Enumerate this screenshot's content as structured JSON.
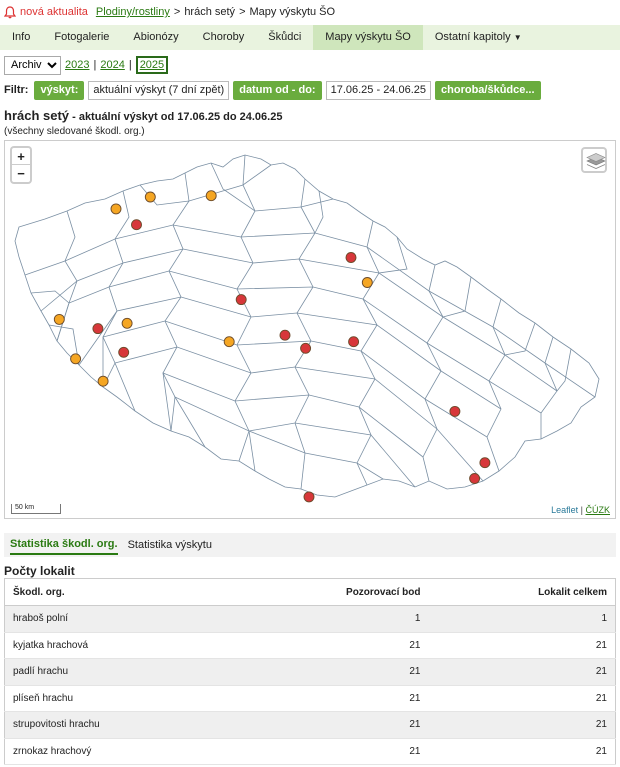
{
  "topbar": {
    "alert_label": "nová aktualita",
    "crumb_link": "Plodiny/rostliny",
    "crumb_sep1": ">",
    "crumb_2": "hrách setý",
    "crumb_sep2": ">",
    "crumb_3": "Mapy výskytu ŠO",
    "icon": "bell-icon"
  },
  "nav": {
    "items": [
      "Info",
      "Fotogalerie",
      "Abionózy",
      "Choroby",
      "Škůdci",
      "Mapy výskytu ŠO",
      "Ostatní kapitoly"
    ],
    "active": "Mapy výskytu ŠO"
  },
  "archive": {
    "select_value": "Archiv",
    "years": [
      "2023",
      "2024",
      "2025"
    ],
    "current_year": "2025",
    "sep": "|"
  },
  "filter": {
    "label": "Filtr:",
    "occurrence_btn": "výskyt:",
    "occurrence_value": "aktuální výskyt (7 dní zpět)",
    "date_btn": "datum od - do:",
    "date_value": "17.06.25 - 24.06.25",
    "disease_btn": "choroba/škůdce..."
  },
  "heading": {
    "crop": "hrách setý",
    "subtitle": " - aktuální výskyt od 17.06.25 do 24.06.25",
    "note": "(všechny sledované škodl. org.)"
  },
  "map": {
    "zoom_in": "+",
    "zoom_out": "−",
    "scale_label": "50 km",
    "attrib_leaflet": "Leaflet",
    "attrib_sep": "|",
    "attrib_cuzk": "ČÚZK",
    "marker_colors": {
      "orange": "#f5a623",
      "red": "#d7373a"
    },
    "markers": [
      {
        "color": "orange",
        "lon": 13.2,
        "lat": 50.66
      },
      {
        "color": "orange",
        "lon": 13.6,
        "lat": 50.75
      },
      {
        "color": "orange",
        "lon": 14.31,
        "lat": 50.76
      },
      {
        "color": "red",
        "lon": 13.44,
        "lat": 50.54
      },
      {
        "color": "red",
        "lon": 15.94,
        "lat": 50.29
      },
      {
        "color": "orange",
        "lon": 16.13,
        "lat": 50.1
      },
      {
        "color": "red",
        "lon": 14.66,
        "lat": 49.97
      },
      {
        "color": "orange",
        "lon": 12.54,
        "lat": 49.82
      },
      {
        "color": "red",
        "lon": 12.99,
        "lat": 49.75
      },
      {
        "color": "orange",
        "lon": 13.33,
        "lat": 49.79
      },
      {
        "color": "red",
        "lon": 13.29,
        "lat": 49.57
      },
      {
        "color": "orange",
        "lon": 12.73,
        "lat": 49.52
      },
      {
        "color": "orange",
        "lon": 13.05,
        "lat": 49.35
      },
      {
        "color": "orange",
        "lon": 14.52,
        "lat": 49.65
      },
      {
        "color": "red",
        "lon": 15.17,
        "lat": 49.7
      },
      {
        "color": "red",
        "lon": 15.41,
        "lat": 49.6
      },
      {
        "color": "red",
        "lon": 15.97,
        "lat": 49.65
      },
      {
        "color": "red",
        "lon": 17.15,
        "lat": 49.12
      },
      {
        "color": "red",
        "lon": 17.5,
        "lat": 48.73
      },
      {
        "color": "red",
        "lon": 17.38,
        "lat": 48.61
      },
      {
        "color": "red",
        "lon": 15.45,
        "lat": 48.47
      }
    ]
  },
  "tabs": {
    "stat_org": "Statistika škodl. org.",
    "stat_occ": "Statistika výskytu"
  },
  "stats": {
    "title": "Počty lokalit",
    "headers": [
      "Škodl. org.",
      "Pozorovací bod",
      "Lokalit celkem"
    ],
    "rows": [
      [
        "hraboš polní",
        "1",
        "1"
      ],
      [
        "kyjatka hrachová",
        "21",
        "21"
      ],
      [
        "padlí hrachu",
        "21",
        "21"
      ],
      [
        "plíseň hrachu",
        "21",
        "21"
      ],
      [
        "strupovitosti hrachu",
        "21",
        "21"
      ],
      [
        "zrnokaz hrachový",
        "21",
        "21"
      ]
    ]
  }
}
